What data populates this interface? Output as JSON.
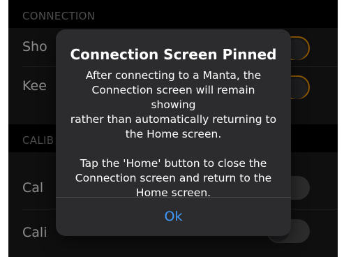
{
  "settings": {
    "sections": [
      {
        "header": "CONNECTION",
        "rows": [
          {
            "label": "Sho",
            "toggle_on": true
          },
          {
            "label": "Kee",
            "toggle_on": true
          }
        ]
      },
      {
        "header": "CALIB",
        "rows": [
          {
            "label": "Cal",
            "toggle_on": false
          },
          {
            "label": "Cali",
            "toggle_on": false
          }
        ]
      }
    ],
    "accent_color": "#ff9f0a"
  },
  "alert": {
    "title": "Connection Screen Pinned",
    "message": "After connecting to a Manta, the\nConnection screen will remain showing\nrather than automatically returning to\nthe Home screen.\n\nTap the 'Home' button to close the\nConnection screen and return to the\nHome screen.",
    "button_label": "Ok",
    "button_color": "#409cff"
  }
}
